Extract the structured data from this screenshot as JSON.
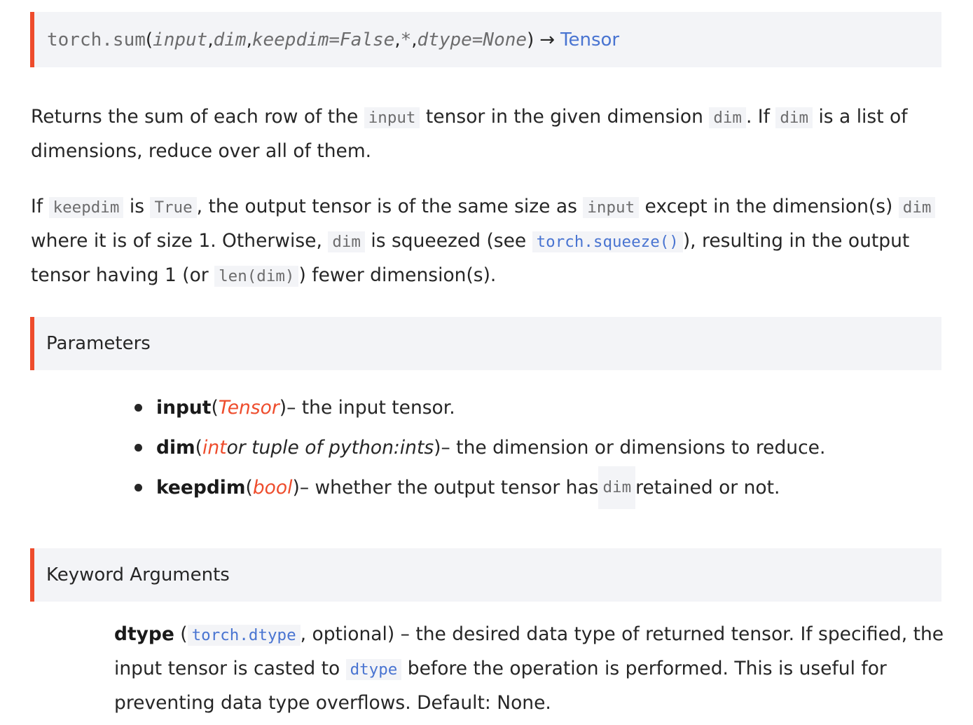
{
  "signature": {
    "function": "torch.sum",
    "open_paren": "(",
    "params": [
      "input",
      "dim",
      "keepdim=False",
      "*",
      "dtype=None"
    ],
    "close_paren": ")",
    "arrow": "→",
    "return_type": "Tensor"
  },
  "description": {
    "p1": {
      "t1": "Returns the sum of each row of the ",
      "c1": "input",
      "t2": " tensor in the given dimension ",
      "c2": "dim",
      "t3": ". If ",
      "c3": "dim",
      "t4": " is a list of dimensions, reduce over all of them."
    },
    "p2": {
      "t1": "If ",
      "c1": "keepdim",
      "t2": " is ",
      "c2": "True",
      "t3": ", the output tensor is of the same size as ",
      "c3": "input",
      "t4": " except in the dimension(s) ",
      "c4": "dim",
      "t5": " where it is of size 1. Otherwise, ",
      "c5": "dim",
      "t6": " is squeezed (see ",
      "link": "torch.squeeze()",
      "t7": "), resulting in the output tensor having 1 (or ",
      "c6": "len(dim)",
      "t8": ") fewer dimension(s)."
    }
  },
  "parameters": {
    "heading": "Parameters",
    "items": [
      {
        "name": "input",
        "open": " (",
        "type": "Tensor",
        "type_rest": "",
        "close": ")",
        "desc": " – the input tensor.",
        "code": "",
        "desc_after": ""
      },
      {
        "name": "dim",
        "open": " (",
        "type": "int",
        "type_rest": " or tuple of python:ints",
        "close": ")",
        "desc": " – the dimension or dimensions to reduce.",
        "code": "",
        "desc_after": ""
      },
      {
        "name": "keepdim",
        "open": " (",
        "type": "bool",
        "type_rest": "",
        "close": ")",
        "desc": " – whether the output tensor has ",
        "code": "dim",
        "desc_after": " retained or not."
      }
    ]
  },
  "keyword_arguments": {
    "heading": "Keyword Arguments",
    "name": "dtype",
    "t1": " (",
    "type_link": "torch.dtype",
    "t2": ", optional) – the desired data type of returned tensor. If specified, the input tensor is casted to ",
    "code": "dtype",
    "t3": " before the operation is performed. This is useful for preventing data type overflows. Default: None."
  },
  "colors": {
    "accent": "#ee4c2c",
    "link": "#4974d1",
    "code_bg": "#f3f4f7",
    "text": "#262626"
  }
}
